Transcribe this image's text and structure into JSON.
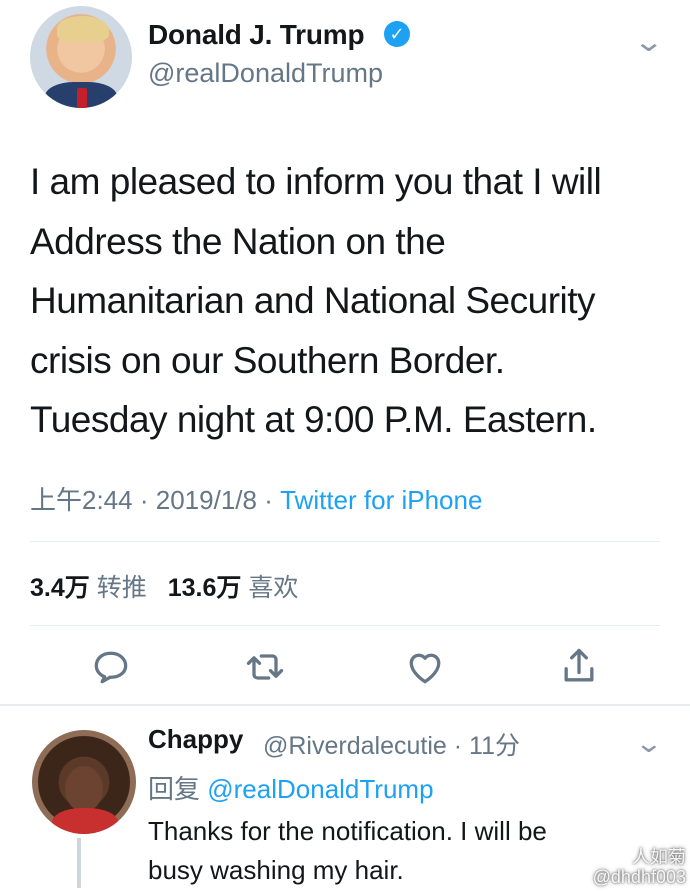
{
  "tweet": {
    "author_name": "Donald J. Trump",
    "verified_mark": "✓",
    "author_handle": "@realDonaldTrump",
    "text_lines": [
      "I am pleased to inform you that I will",
      "Address the Nation on the",
      "Humanitarian and National Security",
      "crisis on our Southern Border.",
      "Tuesday night at 9:00 P.M. Eastern."
    ],
    "time": "上午2:44",
    "date": "2019/1/8",
    "source": "Twitter for iPhone",
    "separator": "·",
    "retweets_count": "3.4万",
    "retweets_label": "转推",
    "likes_count": "13.6万",
    "likes_label": "喜欢"
  },
  "actions": [
    {
      "name": "reply",
      "icon": "reply-icon"
    },
    {
      "name": "retweet",
      "icon": "retweet-icon"
    },
    {
      "name": "like",
      "icon": "heart-icon"
    },
    {
      "name": "share",
      "icon": "share-icon"
    }
  ],
  "reply": {
    "author_name": "Chappy",
    "author_handle": "@Riverdalecutie",
    "separator": "·",
    "time_ago": "11分",
    "reply_label": "回复",
    "reply_to": "@realDonaldTrump",
    "text_lines": [
      "Thanks for the notification. I will be",
      "busy washing my hair."
    ]
  },
  "watermark": {
    "line1": "人如菊",
    "line2": "@dhdhf003"
  },
  "colors": {
    "accent": "#1da1f2",
    "muted": "#657786",
    "text": "#14171a",
    "divider": "#e6ecf0"
  }
}
